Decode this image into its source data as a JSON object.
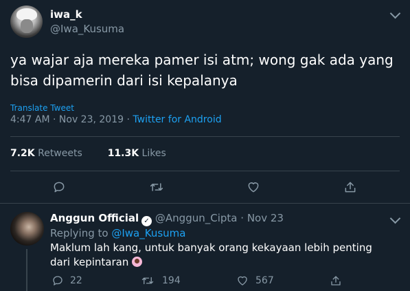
{
  "main_tweet": {
    "author_name": "iwa_k",
    "author_handle": "@Iwa_Kusuma",
    "text": "ya wajar aja mereka pamer isi atm; wong gak ada yang bisa dipamerin dari isi kepalanya",
    "translate_label": "Translate Tweet",
    "time": "4:47 AM",
    "date": "Nov 23, 2019",
    "source": "Twitter for Android",
    "retweets_count": "7.2K",
    "retweets_label": "Retweets",
    "likes_count": "11.3K",
    "likes_label": "Likes"
  },
  "reply": {
    "author_name": "Anggun Official",
    "author_handle": "@Anggun_Cipta",
    "date": "Nov 23",
    "replying_prefix": "Replying to",
    "replying_to": "@Iwa_Kusuma",
    "text": "Maklum lah kang, untuk banyak orang kekayaan lebih penting dari kepintaran",
    "reply_count": "22",
    "retweet_count": "194",
    "like_count": "567"
  },
  "colors": {
    "background": "#15202b",
    "text_secondary": "#8899a6",
    "accent": "#1da1f2",
    "divider": "#38444d"
  }
}
